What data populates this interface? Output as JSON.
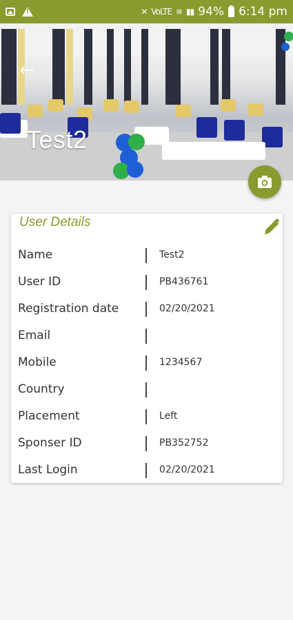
{
  "status_bar": {
    "battery": "94%",
    "time": "6:14 pm",
    "network": "VoLTE"
  },
  "header": {
    "title": "Test2"
  },
  "card": {
    "title": "User Details",
    "rows": [
      {
        "label": "Name",
        "value": "Test2"
      },
      {
        "label": "User ID",
        "value": "PB436761"
      },
      {
        "label": "Registration date",
        "value": "02/20/2021"
      },
      {
        "label": "Email",
        "value": ""
      },
      {
        "label": "Mobile",
        "value": "1234567"
      },
      {
        "label": "Country",
        "value": ""
      },
      {
        "label": "Placement",
        "value": "Left"
      },
      {
        "label": "Sponser ID",
        "value": "PB352752"
      },
      {
        "label": "Last Login",
        "value": "02/20/2021"
      }
    ]
  },
  "colors": {
    "accent": "#8a9a2e"
  }
}
